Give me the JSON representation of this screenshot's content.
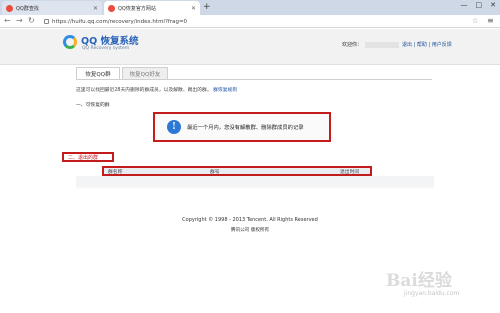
{
  "browser": {
    "tabs": [
      {
        "label": "QQ群查找"
      },
      {
        "label": "QQ恢复官方网站"
      }
    ],
    "new_tab": "+",
    "url": "https://huifu.qq.com/recovery/index.html?frag=0",
    "window_controls": [
      "—",
      "□",
      "✕"
    ]
  },
  "header": {
    "logo_title": "QQ 恢复系统",
    "logo_subtitle": "QQ Recovery system",
    "welcome_label": "欢迎你：",
    "links": "退出 | 帮助 | 用户反馈"
  },
  "tabs": [
    {
      "label": "恢复QQ群"
    },
    {
      "label": "恢复QQ好友"
    }
  ],
  "intro": {
    "text": "这里可以找回最近28天内删除的群成员，以及解散、踢出的群。",
    "link": "群恢复规则"
  },
  "section1": {
    "title": "一、可恢复的群"
  },
  "notice": {
    "text": "最近一个月内，您没有解散群、删除群成员的记录"
  },
  "section2": {
    "title": "二、退出的群"
  },
  "table": {
    "columns": [
      "群名称",
      "群号",
      "退出时间"
    ]
  },
  "footer": {
    "copyright": "Copyright © 1998 - 2013 Tencent. All Rights Reserved",
    "company": "腾讯公司 版权所有"
  },
  "watermark": {
    "main": "Bai经验",
    "sub": "jingyan.baidu.com"
  }
}
